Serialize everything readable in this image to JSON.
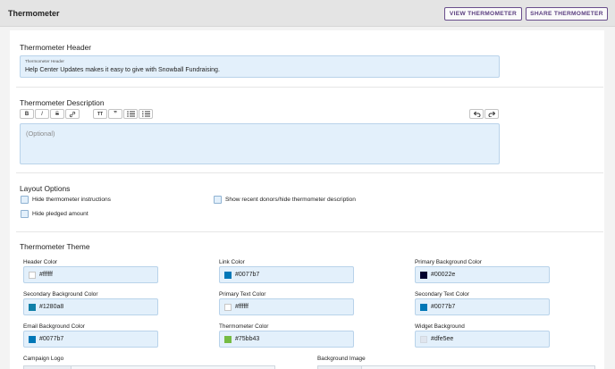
{
  "header": {
    "title": "Thermometer",
    "view_button": "VIEW THERMOMETER",
    "share_button": "SHARE THERMOMETER"
  },
  "thermometer_header": {
    "section_title": "Thermometer Header",
    "field_label": "Thermometer Header",
    "value": "Help Center Updates makes it easy to give with Snowball Fundraising."
  },
  "description": {
    "section_title": "Thermometer Description",
    "placeholder": "(Optional)",
    "toolbar": {
      "bold": "B",
      "italic": "I",
      "strike": "S",
      "heading": "TT",
      "quote": "”",
      "icons": [
        "bold-icon",
        "italic-icon",
        "strikethrough-icon",
        "link-icon",
        "heading-icon",
        "quote-icon",
        "bullet-list-icon",
        "numbered-list-icon",
        "undo-icon",
        "redo-icon"
      ]
    }
  },
  "layout_options": {
    "section_title": "Layout Options",
    "options": [
      {
        "label": "Hide thermometer instructions",
        "checked": false
      },
      {
        "label": "Show recent donors/hide thermometer description",
        "checked": false
      },
      {
        "label": "Hide pledged amount",
        "checked": false
      }
    ]
  },
  "theme": {
    "section_title": "Thermometer Theme",
    "fields": [
      {
        "label": "Header Color",
        "value": "#ffffff",
        "swatch": "#ffffff"
      },
      {
        "label": "Link Color",
        "value": "#0077b7",
        "swatch": "#0077b7"
      },
      {
        "label": "Primary Background Color",
        "value": "#00022e",
        "swatch": "#00022e"
      },
      {
        "label": "Secondary Background Color",
        "value": "#1280a8",
        "swatch": "#1280a8"
      },
      {
        "label": "Primary Text Color",
        "value": "#ffffff",
        "swatch": "#ffffff"
      },
      {
        "label": "Secondary Text Color",
        "value": "#0077b7",
        "swatch": "#0077b7"
      },
      {
        "label": "Email Background Color",
        "value": "#0077b7",
        "swatch": "#0077b7"
      },
      {
        "label": "Thermometer Color",
        "value": "#75bb43",
        "swatch": "#75bb43"
      },
      {
        "label": "Widget Background",
        "value": "#dfe5ee",
        "swatch": "#dfe5ee"
      }
    ],
    "campaign_logo_label": "Campaign Logo",
    "background_image_label": "Background Image"
  },
  "colors": {
    "accent": "#5b3f80",
    "input_bg": "#e3f0fb",
    "input_border": "#b9d3ea"
  }
}
